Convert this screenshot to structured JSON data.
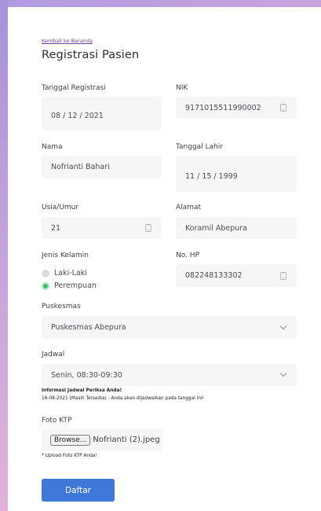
{
  "back_link": "Kembali ke Beranda",
  "title": "Registrasi Pasien",
  "fields": {
    "tanggal_registrasi": {
      "label": "Tanggal Registrasi",
      "value": "08 / 12 / 2021"
    },
    "nik": {
      "label": "NIK",
      "value": "9171015511990002"
    },
    "nama": {
      "label": "Nama",
      "value": "Nofrianti Bahari"
    },
    "tanggal_lahir": {
      "label": "Tanggal Lahir",
      "value": "11 / 15 / 1999"
    },
    "usia": {
      "label": "Usia/Umur",
      "value": "21"
    },
    "alamat": {
      "label": "Alamat",
      "value": "Koramil Abepura"
    },
    "jenis_kelamin": {
      "label": "Jenis Kelamin",
      "options": [
        "Laki-Laki",
        "Perempuan"
      ],
      "selected": "Perempuan"
    },
    "no_hp": {
      "label": "No. HP",
      "value": "082248133302"
    },
    "puskesmas": {
      "label": "Puskesmas",
      "value": "Puskesmas Abepura"
    },
    "jadwal": {
      "label": "Jadwal",
      "value": "Senin, 08:30-09:30"
    }
  },
  "jadwal_info": {
    "line1": "Informasi Jadwal Periksa Anda!",
    "line2": "16-08-2021 (Masih Tersedia) - Anda akan dijadwalkan pada tanggal ini!"
  },
  "foto_ktp": {
    "label": "Foto KTP",
    "button": "Browse...",
    "filename": "Nofrianti (2).jpeg",
    "note": "* Upload Foto KTP Anda!"
  },
  "submit": "Daftar",
  "colors": {
    "accent": "#3f78d8",
    "radio_selected": "#3fbf6a",
    "link": "#6b3fa0",
    "field_bg": "#f6f6f7"
  }
}
